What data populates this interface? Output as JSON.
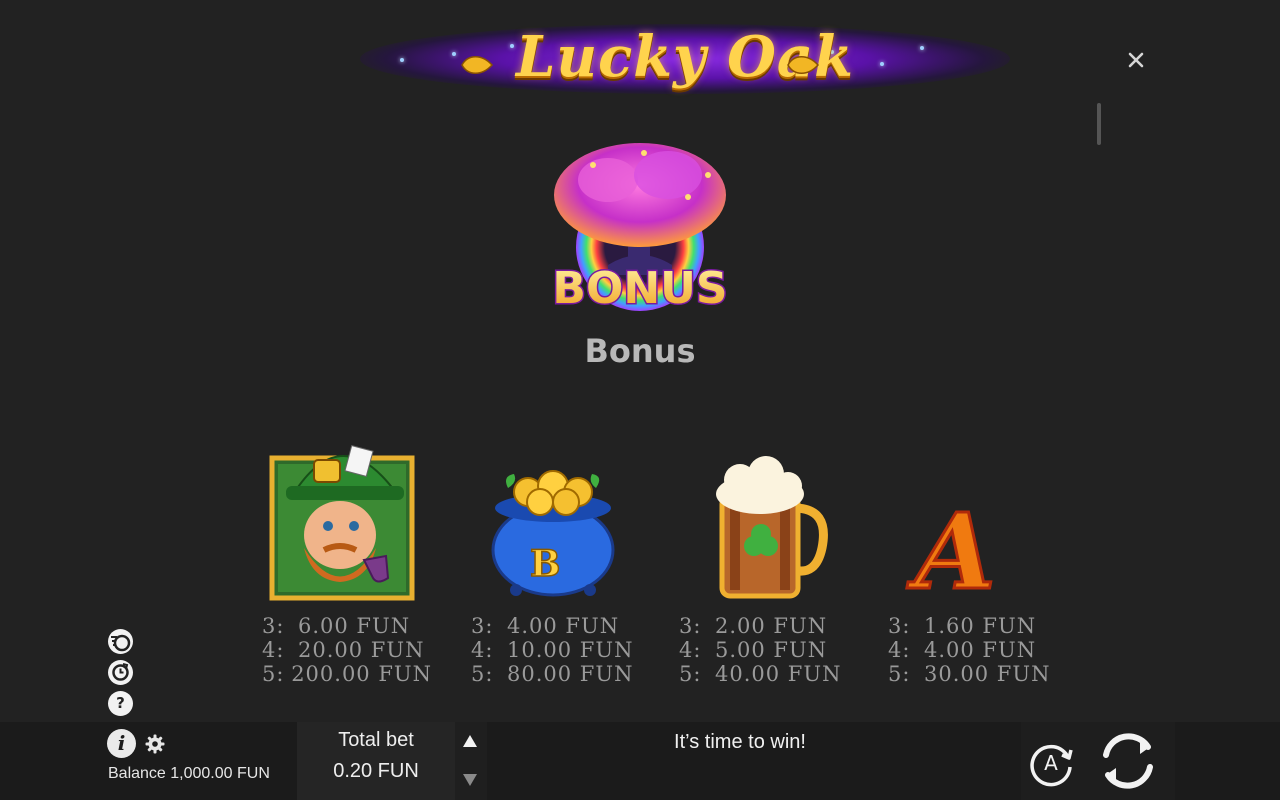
{
  "header": {
    "logo_text": "Lucky Oak",
    "close_icon": "close-icon"
  },
  "bonus": {
    "symbol_label": "BONUS",
    "title": "Bonus"
  },
  "paytable": [
    {
      "symbol": "leprechaun",
      "rows": [
        [
          "3:",
          "6.00 FUN"
        ],
        [
          "4:",
          "20.00 FUN"
        ],
        [
          "5:",
          "200.00 FUN"
        ]
      ]
    },
    {
      "symbol": "pot-of-gold",
      "symbol_letter": "B",
      "rows": [
        [
          "3:",
          "4.00 FUN"
        ],
        [
          "4:",
          "10.00 FUN"
        ],
        [
          "5:",
          "80.00 FUN"
        ]
      ]
    },
    {
      "symbol": "beer-mug",
      "rows": [
        [
          "3:",
          "2.00 FUN"
        ],
        [
          "4:",
          "5.00 FUN"
        ],
        [
          "5:",
          "40.00 FUN"
        ]
      ]
    },
    {
      "symbol": "letter-a",
      "symbol_letter": "A",
      "rows": [
        [
          "3:",
          "1.60 FUN"
        ],
        [
          "4:",
          "4.00 FUN"
        ],
        [
          "5:",
          "30.00 FUN"
        ]
      ]
    }
  ],
  "side_icons": [
    "turbo-icon",
    "history-icon",
    "help-icon"
  ],
  "side_icon_glyphs": {
    "help": "?"
  },
  "bottombar": {
    "info_glyph": "i",
    "balance": "Balance 1,000.00 FUN",
    "total_bet_label": "Total bet",
    "total_bet_value": "0.20 FUN",
    "message": "It’s time to win!",
    "auto_label": "A"
  },
  "colors": {
    "background": "#222222",
    "bar": "#1b1b1b",
    "gold": "#ffd34d",
    "purple_glow": "#8a2be2",
    "pay_text": "#9a9a9a"
  }
}
